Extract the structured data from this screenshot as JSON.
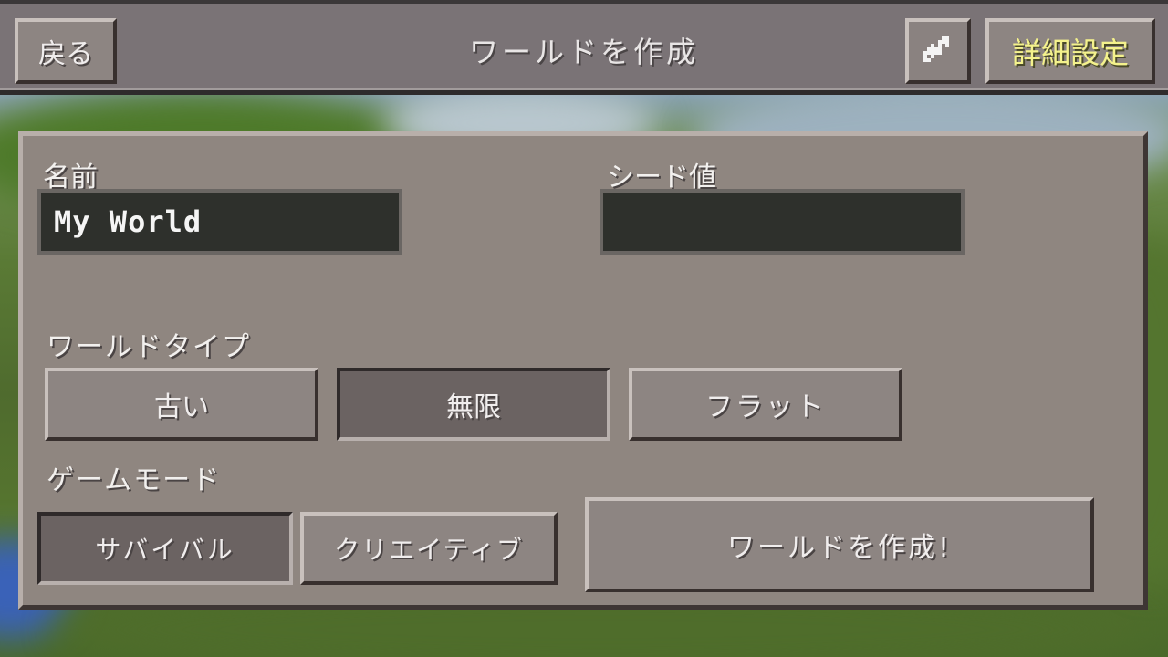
{
  "header": {
    "title": "ワールドを作成",
    "back_label": "戻る",
    "share_icon": "share-arrows-icon",
    "advanced_label": "詳細設定"
  },
  "form": {
    "name_label": "名前",
    "name_value": "My World",
    "seed_label": "シード値",
    "seed_value": "",
    "world_type_label": "ワールドタイプ",
    "world_types": [
      {
        "label": "古い",
        "selected": false
      },
      {
        "label": "無限",
        "selected": true
      },
      {
        "label": "フラット",
        "selected": false
      }
    ],
    "game_mode_label": "ゲームモード",
    "game_modes": [
      {
        "label": "サバイバル",
        "selected": true
      },
      {
        "label": "クリエイティブ",
        "selected": false
      }
    ],
    "create_label": "ワールドを作成!"
  },
  "colors": {
    "advanced_text": "#f4f28c",
    "panel": "#8f8680",
    "header": "#7a7376"
  }
}
